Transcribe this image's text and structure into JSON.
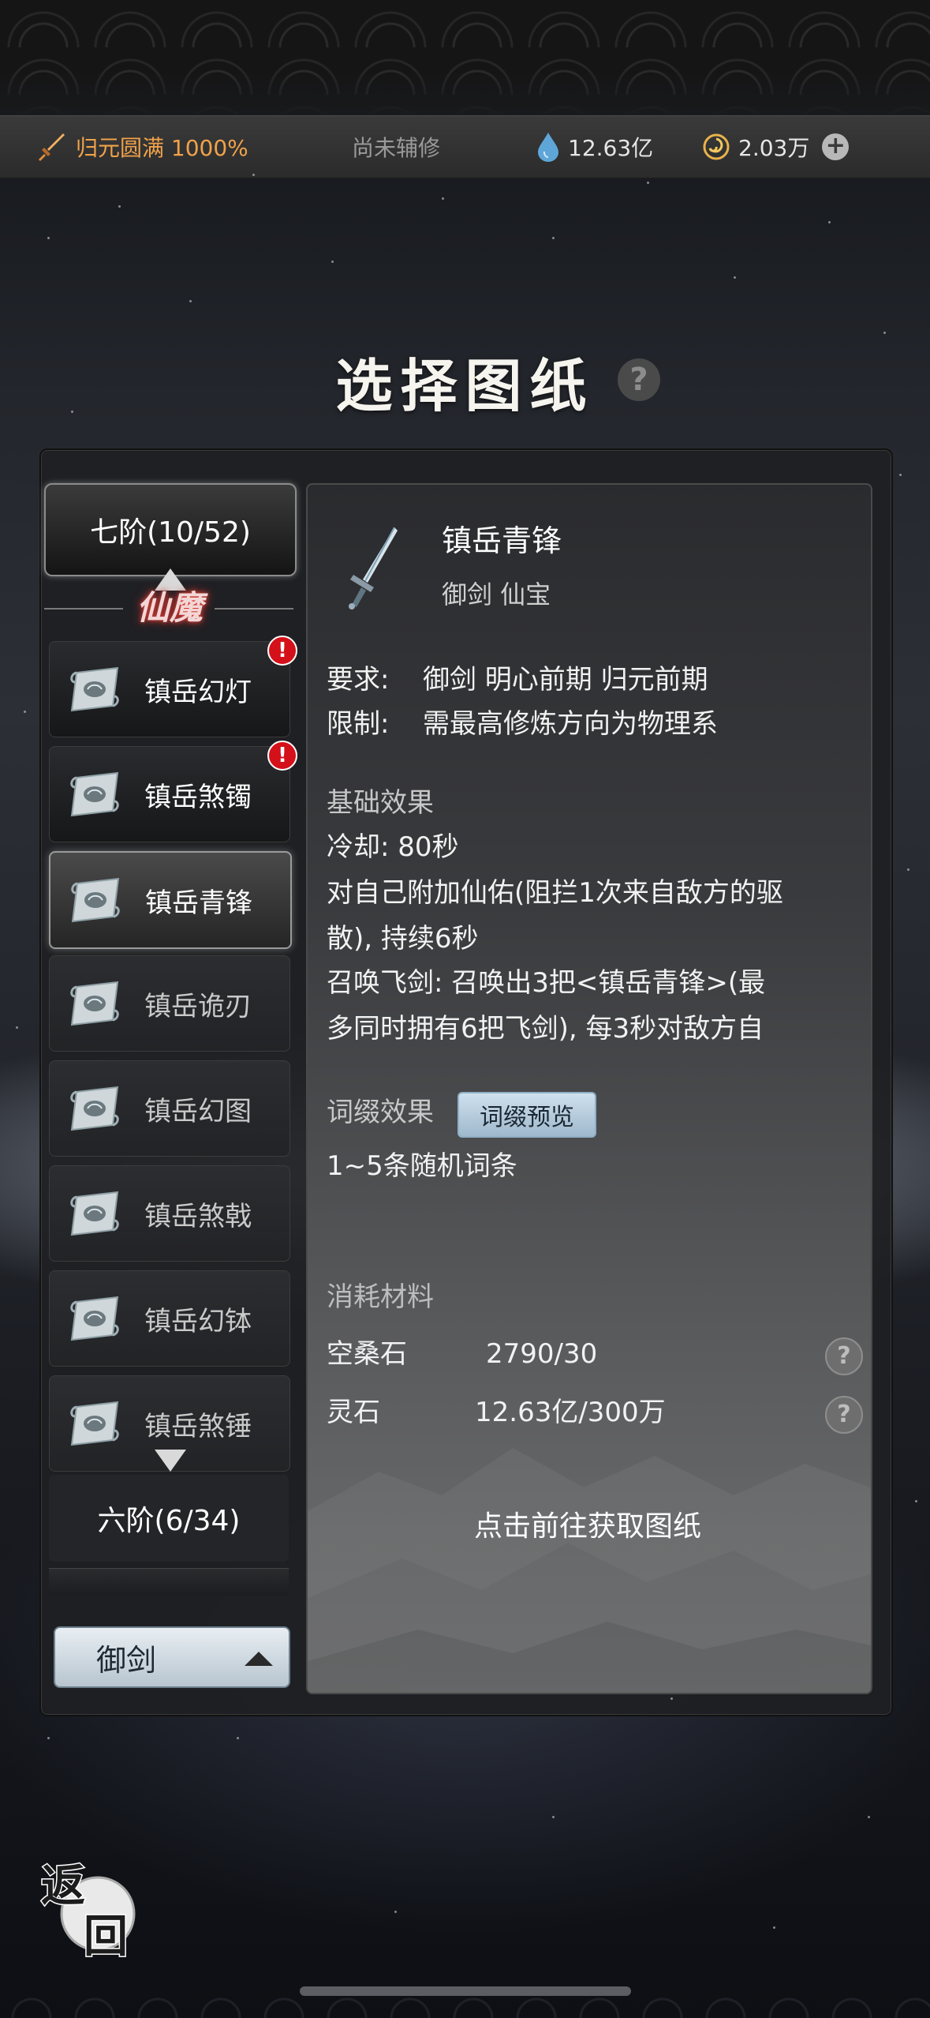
{
  "topbar": {
    "cultivation": "归元圆满 1000%",
    "assist": "尚未辅修",
    "spirit_stone": "12.63亿",
    "coins": "2.03万",
    "icons": [
      "sword-icon",
      "water-drop-icon",
      "coin-swirl-icon",
      "plus-icon"
    ]
  },
  "title": "选择图纸",
  "title_help": "?",
  "sidebar": {
    "tier7": "七阶(10/52)",
    "category": "仙魔",
    "items": [
      {
        "label": "镇岳幻灯",
        "alert": "!"
      },
      {
        "label": "镇岳煞镯",
        "alert": "!"
      },
      {
        "label": "镇岳青锋"
      },
      {
        "label": "镇岳诡刃"
      },
      {
        "label": "镇岳幻图"
      },
      {
        "label": "镇岳煞戟"
      },
      {
        "label": "镇岳幻钵"
      },
      {
        "label": "镇岳煞锤"
      }
    ],
    "tier6": "六阶(6/34)",
    "filter": "御剑"
  },
  "detail": {
    "name": "镇岳青锋",
    "subtitle": "御剑  仙宝",
    "req_label": "要求:",
    "req_value": "御剑  明心前期 归元前期",
    "limit_label": "限制:",
    "limit_value": "需最高修炼方向为物理系",
    "base_effect_title": "基础效果",
    "cooldown": "冷却: 80秒",
    "effect1_line1": "对自己附加仙佑(阻拦1次来自敌方的驱",
    "effect1_line2": "散), 持续6秒",
    "effect2_line1": "召唤飞剑: 召唤出3把<镇岳青锋>(最",
    "effect2_line2": "多同时拥有6把飞剑), 每3秒对敌方自",
    "affix_title": "词缀效果",
    "affix_button": "词缀预览",
    "affix_value": "1~5条随机词条",
    "materials_title": "消耗材料",
    "materials": [
      {
        "name": "空桑石",
        "amount": "2790/30",
        "help": "?"
      },
      {
        "name": "灵石",
        "amount": "12.63亿/300万",
        "help": "?"
      }
    ],
    "goto": "点击前往获取图纸"
  },
  "back_button": {
    "line1": "返",
    "line2": "回"
  }
}
